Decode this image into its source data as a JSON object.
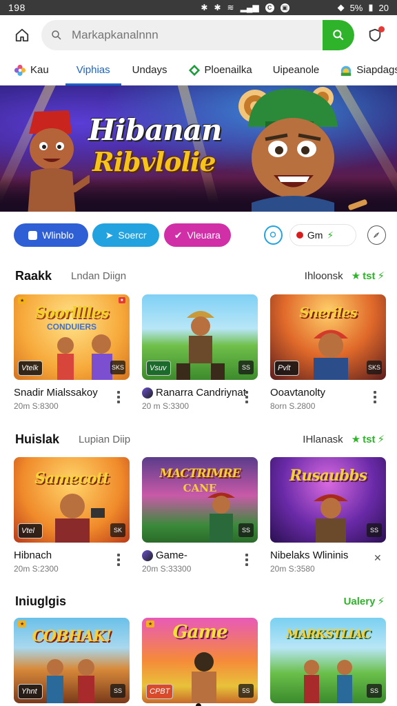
{
  "status": {
    "time": "198",
    "battery": "5%",
    "clock": "20"
  },
  "search": {
    "placeholder": "Markapkanalnnn"
  },
  "tabs": [
    {
      "label": "Kau",
      "icon": "flower-icon"
    },
    {
      "label": "Viphias",
      "active": true
    },
    {
      "label": "Undays"
    },
    {
      "label": "Ploenailka",
      "icon": "diamond-icon"
    },
    {
      "label": "Uipeanole"
    },
    {
      "label": "Siapdags",
      "icon": "sunrise-icon"
    }
  ],
  "hero": {
    "title_line1": "Hibanan",
    "title_line2": "Ribvlolie"
  },
  "pills": [
    {
      "label": "Wlinblo",
      "color": "#2f5fd4"
    },
    {
      "label": "Soercr",
      "color": "#22a3e0"
    },
    {
      "label": "Vleuara",
      "color": "#d12fa8"
    }
  ],
  "gm_chip": {
    "label": "Gm"
  },
  "sections": [
    {
      "title": "Raakk",
      "subtitle": "Lndan Diign",
      "link": "Ihloonsk",
      "green_link": "tst",
      "cards": [
        {
          "thumb_title": "Soorlllles",
          "thumb_sub": "CONDUIERS",
          "badge_left": "Vtelk",
          "badge_right": "SKS",
          "name": "Snadir Mialssakoy",
          "meta": "20m S:8300",
          "theme": "yellow"
        },
        {
          "thumb_title": "",
          "badge_left": "Vsuv",
          "badge_right": "SS",
          "name": "Ranarra Candriynat",
          "meta": "20 m S:3300",
          "theme": "green",
          "has_avatar": true
        },
        {
          "thumb_title": "Sneriles",
          "badge_left": "Pvlt",
          "badge_right": "SKS",
          "name": "Ooavtanolty",
          "meta": "8orn S.2800",
          "theme": "stage"
        }
      ]
    },
    {
      "title": "Huislak",
      "subtitle": "Lupian Diip",
      "link": "IHlanask",
      "green_link": "tst",
      "cards": [
        {
          "thumb_title": "Samecott",
          "badge_left": "Vtel",
          "badge_right": "SK",
          "name": "Hibnach",
          "meta": "20m S:2300",
          "theme": "orange"
        },
        {
          "thumb_title": "MACTRIMRE",
          "thumb_sub": "CANE",
          "badge_left": "",
          "badge_right": "SS",
          "name": "Game-",
          "meta": "20m S:33300",
          "theme": "purplegreen",
          "has_avatar": true
        },
        {
          "thumb_title": "Rusaubbs",
          "badge_left": "",
          "badge_right": "SS",
          "name": "Nibelaks Wlininis",
          "meta": "20m S:3580",
          "theme": "purple",
          "close": true
        }
      ]
    },
    {
      "title": "Iniuglgis",
      "subtitle": "",
      "link": "",
      "green_link": "Ualery",
      "cards": [
        {
          "thumb_title": "COBHAK!",
          "badge_left": "Yhnt",
          "badge_right": "SS",
          "theme": "jungle"
        },
        {
          "thumb_title": "Game",
          "badge_left": "CPBT",
          "badge_right": "5S",
          "theme": "sunset"
        },
        {
          "thumb_title": "MARKSTLIAC",
          "badge_left": "",
          "badge_right": "SS",
          "theme": "field"
        }
      ]
    }
  ],
  "colors": {
    "accent_blue": "#1a63c7",
    "accent_green": "#2fb32a"
  }
}
